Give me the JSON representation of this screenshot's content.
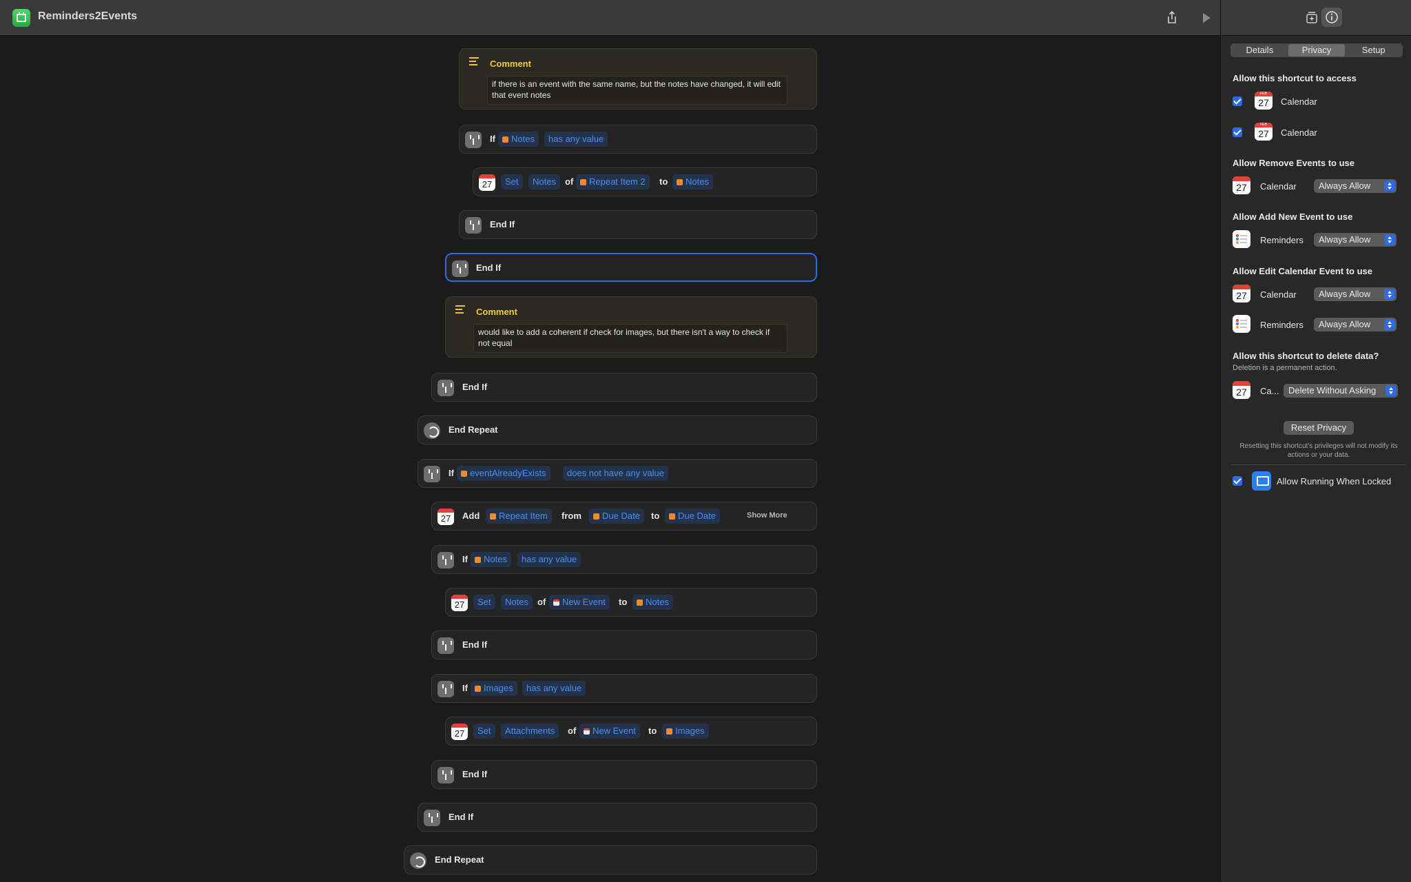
{
  "app": {
    "title": "Reminders2Events"
  },
  "sidebar": {
    "tabs": [
      {
        "label": "Details"
      },
      {
        "label": "Privacy"
      },
      {
        "label": "Setup"
      }
    ],
    "access_heading": "Allow this shortcut to access",
    "access_items": [
      {
        "label": "Calendar",
        "checked": true,
        "month": "FEB",
        "day": "27"
      },
      {
        "label": "Calendar",
        "checked": true,
        "month": "FEB",
        "day": "27"
      }
    ],
    "sections": [
      {
        "heading": "Allow Remove Events to use",
        "rows": [
          {
            "app": "Calendar",
            "icon": "calendar-icon",
            "permission": "Always Allow"
          }
        ]
      },
      {
        "heading": "Allow Add New Event to use",
        "rows": [
          {
            "app": "Reminders",
            "icon": "reminders-icon",
            "permission": "Always Allow"
          }
        ]
      },
      {
        "heading": "Allow Edit Calendar Event to use",
        "rows": [
          {
            "app": "Calendar",
            "icon": "calendar-icon",
            "permission": "Always Allow"
          },
          {
            "app": "Reminders",
            "icon": "reminders-icon",
            "permission": "Always Allow"
          }
        ]
      }
    ],
    "delete_heading": "Allow this shortcut to delete data?",
    "delete_note": "Deletion is a permanent action.",
    "delete_row": {
      "app": "Ca...",
      "permission": "Delete Without Asking"
    },
    "reset_button": "Reset Privacy",
    "reset_note": "Resetting this shortcut's privileges will not modify its actions or your data.",
    "locked": {
      "label": "Allow Running When Locked",
      "checked": true
    }
  },
  "editor": {
    "comment1": {
      "title": "Comment",
      "body": "if there is an event with the same name, but the notes have changed, it will edit that event notes"
    },
    "comment2": {
      "title": "Comment",
      "body": "would like to add a coherent if check for images, but there isn't a way to check if not equal"
    },
    "words": {
      "if": "If",
      "end_if": "End If",
      "end_repeat": "End Repeat",
      "set": "Set",
      "of": "of",
      "to": "to",
      "add": "Add",
      "from": "from",
      "show_more": "Show More"
    },
    "tokens": {
      "notes": "Notes",
      "has_any_value": "has any value",
      "repeat_item_2": "Repeat Item 2",
      "event_already_exists": "eventAlreadyExists",
      "does_not_have_any_value": "does not have any value",
      "repeat_item": "Repeat Item",
      "due_date": "Due Date",
      "new_event": "New Event",
      "images": "Images",
      "attachments": "Attachments"
    },
    "cal_day": "27"
  }
}
